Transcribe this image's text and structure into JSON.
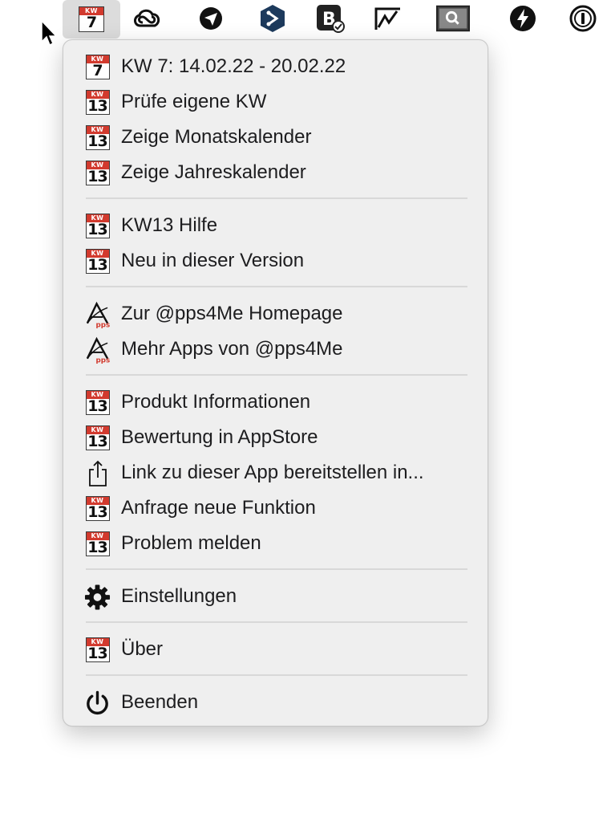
{
  "menubar": {
    "items": [
      {
        "name": "kw-calendar-icon",
        "badge_top": "KW",
        "badge_num": "7"
      },
      {
        "name": "creative-cloud-icon"
      },
      {
        "name": "paper-plane-icon"
      },
      {
        "name": "hexagon-app-icon"
      },
      {
        "name": "bbedit-icon"
      },
      {
        "name": "activity-chart-icon"
      },
      {
        "name": "search-window-icon"
      },
      {
        "name": "lightning-icon"
      },
      {
        "name": "onepassword-icon"
      }
    ]
  },
  "menu": {
    "header": {
      "label": "KW 7:  14.02.22 - 20.02.22",
      "badge_top": "KW",
      "badge_num": "7"
    },
    "group1": [
      {
        "label": "Prüfe eigene KW",
        "badge_top": "KW",
        "badge_num": "13"
      },
      {
        "label": "Zeige Monatskalender",
        "badge_top": "KW",
        "badge_num": "13"
      },
      {
        "label": "Zeige Jahreskalender",
        "badge_top": "KW",
        "badge_num": "13"
      }
    ],
    "group2": [
      {
        "label": "KW13 Hilfe",
        "badge_top": "KW",
        "badge_num": "13"
      },
      {
        "label": "Neu in dieser Version",
        "badge_top": "KW",
        "badge_num": "13"
      }
    ],
    "group3": [
      {
        "label": "Zur @pps4Me Homepage",
        "icon": "apps4me-logo-icon"
      },
      {
        "label": "Mehr Apps von @pps4Me",
        "icon": "apps4me-logo-icon"
      }
    ],
    "group4": [
      {
        "label": "Produkt Informationen",
        "badge_top": "KW",
        "badge_num": "13"
      },
      {
        "label": "Bewertung in AppStore",
        "badge_top": "KW",
        "badge_num": "13"
      },
      {
        "label": "Link zu dieser App bereitstellen in...",
        "icon": "share-icon"
      },
      {
        "label": "Anfrage neue Funktion",
        "badge_top": "KW",
        "badge_num": "13"
      },
      {
        "label": "Problem melden",
        "badge_top": "KW",
        "badge_num": "13"
      }
    ],
    "settings": {
      "label": "Einstellungen",
      "icon": "gear-icon"
    },
    "about": {
      "label": "Über",
      "badge_top": "KW",
      "badge_num": "13"
    },
    "quit": {
      "label": "Beenden",
      "icon": "power-icon"
    }
  },
  "colors": {
    "badge_red": "#d23a2e",
    "menu_bg": "#efefef",
    "separator": "#d8d8d8"
  }
}
